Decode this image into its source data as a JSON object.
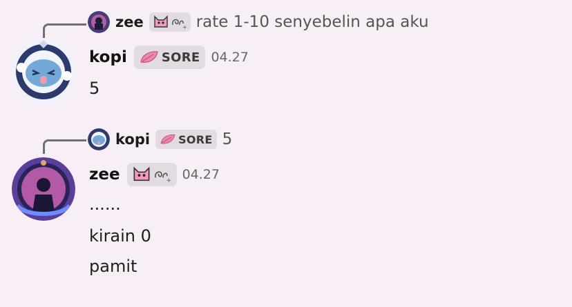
{
  "messages": [
    {
      "reply": {
        "author": "zee",
        "text": "rate 1-10 senyebelin apa aku"
      },
      "author": "kopi",
      "tag": "SORE",
      "time": "04.27",
      "lines": [
        "5"
      ]
    },
    {
      "reply": {
        "author": "kopi",
        "tag": "SORE",
        "text": "5"
      },
      "author": "zee",
      "time": "04.27",
      "lines": [
        "......",
        "kirain 0",
        "pamit"
      ]
    }
  ],
  "icons": {
    "zee_tag": "pink-cat-icon",
    "kopi_tag": "pink-leaf-icon"
  },
  "colors": {
    "background": "#f8eff6",
    "tag_bg": "#e2dce2",
    "reply_line": "#6e6f74"
  }
}
